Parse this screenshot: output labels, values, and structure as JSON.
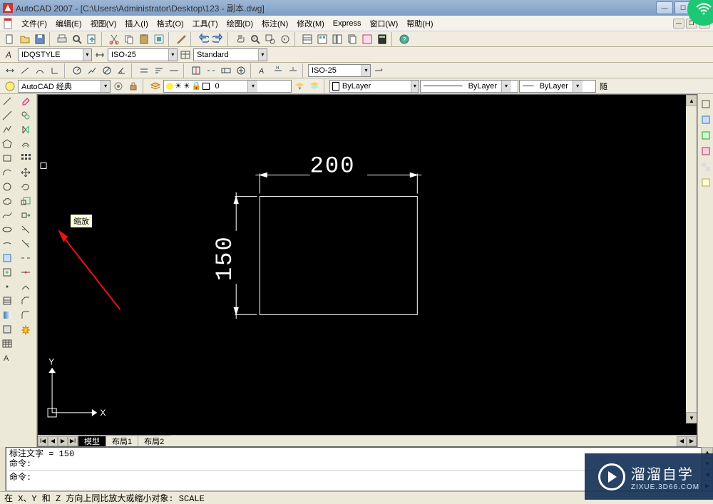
{
  "app": {
    "title": "AutoCAD 2007 - [C:\\Users\\Administrator\\Desktop\\123 - 副本.dwg]"
  },
  "menu": {
    "items": [
      "文件(F)",
      "编辑(E)",
      "视图(V)",
      "插入(I)",
      "格式(O)",
      "工具(T)",
      "绘图(D)",
      "标注(N)",
      "修改(M)",
      "Express",
      "窗口(W)",
      "帮助(H)"
    ]
  },
  "toolbar2": {
    "style1": "IDQSTYLE",
    "style2": "ISO-25",
    "style3": "Standard"
  },
  "toolbar3": {
    "dim_combo": "ISO-25"
  },
  "toolbar4": {
    "workspace": "AutoCAD 经典",
    "layer_value": "0",
    "bylayer1": "ByLayer",
    "bylayer2": "ByLayer",
    "bylayer3": "ByLayer",
    "follow": "随"
  },
  "drawing": {
    "dim_width": "200",
    "dim_height": "150",
    "axis_x": "X",
    "axis_y": "Y"
  },
  "tooltip": {
    "scale": "缩放"
  },
  "tabs": {
    "model": "模型",
    "layout1": "布局1",
    "layout2": "布局2"
  },
  "cmd": {
    "line1": "标注文字 = 150",
    "line2": "命令:",
    "line3": "命令:"
  },
  "status": {
    "text": "在 X、Y 和 Z 方向上同比放大或缩小对象:  SCALE"
  },
  "watermark": {
    "big": "溜溜自学",
    "small": "ZIXUE.3D66.COM"
  }
}
